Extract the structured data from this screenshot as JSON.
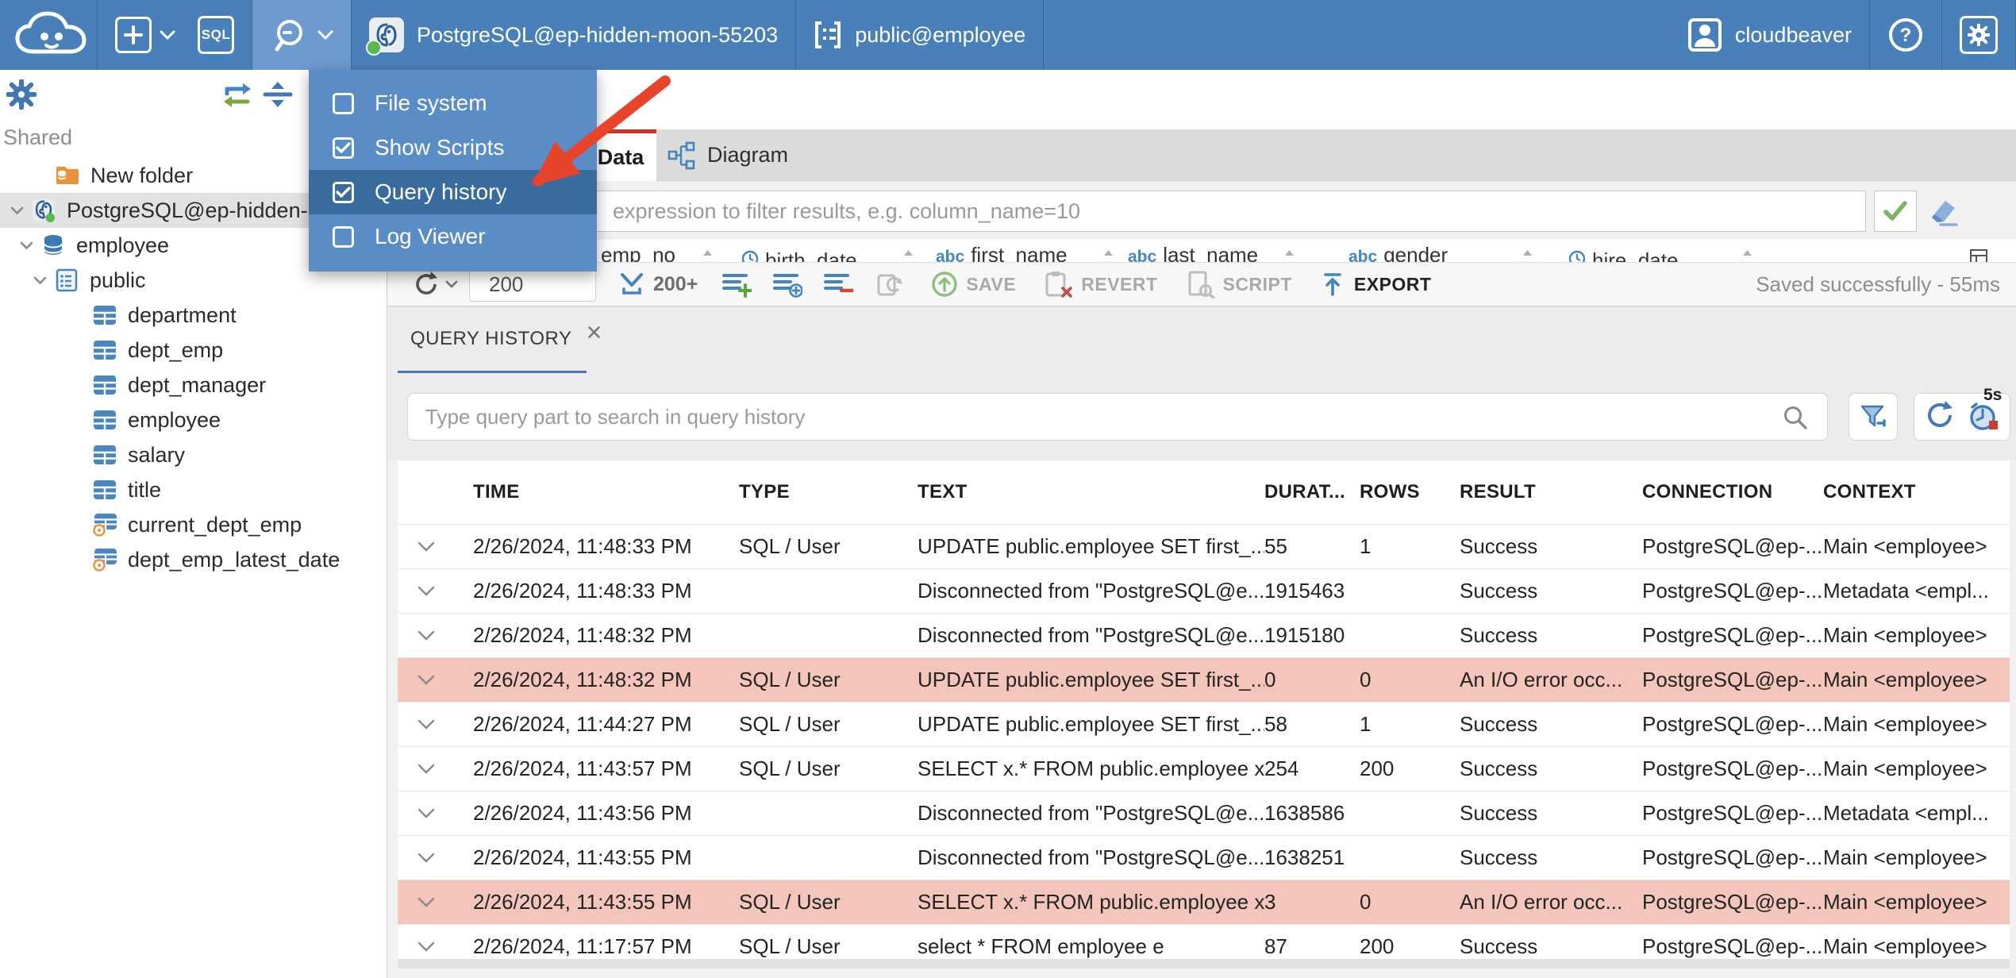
{
  "colors": {
    "topbar": "#4a80ba",
    "accent_red": "#d2302c",
    "error_row": "#f3c5bb",
    "tab_underline": "#4878ad",
    "icon_blue": "#4584c0"
  },
  "topbar": {
    "sql_label": "SQL",
    "connection_name": "PostgreSQL@ep-hidden-moon-55203",
    "schema_context": "public@employee",
    "username": "cloudbeaver"
  },
  "tools_menu": {
    "items": [
      {
        "label": "File system",
        "checked": false,
        "highlighted": false
      },
      {
        "label": "Show Scripts",
        "checked": true,
        "highlighted": false
      },
      {
        "label": "Query history",
        "checked": true,
        "highlighted": true
      },
      {
        "label": "Log Viewer",
        "checked": false,
        "highlighted": false
      }
    ]
  },
  "sidebar": {
    "section_label": "Shared",
    "items": [
      {
        "label": "New folder",
        "icon": "folder",
        "level": 0,
        "chevron": false,
        "selected": false
      },
      {
        "label": "PostgreSQL@ep-hidden-",
        "icon": "postgres",
        "level": 0,
        "chevron": true,
        "selected": true
      },
      {
        "label": "employee",
        "icon": "database",
        "level": 1,
        "chevron": true,
        "selected": false
      },
      {
        "label": "public",
        "icon": "schema",
        "level": 2,
        "chevron": true,
        "selected": false
      },
      {
        "label": "department",
        "icon": "table",
        "level": 3,
        "chevron": false,
        "selected": false
      },
      {
        "label": "dept_emp",
        "icon": "table",
        "level": 3,
        "chevron": false,
        "selected": false
      },
      {
        "label": "dept_manager",
        "icon": "table",
        "level": 3,
        "chevron": false,
        "selected": false
      },
      {
        "label": "employee",
        "icon": "table",
        "level": 3,
        "chevron": false,
        "selected": false
      },
      {
        "label": "salary",
        "icon": "table",
        "level": 3,
        "chevron": false,
        "selected": false
      },
      {
        "label": "title",
        "icon": "table",
        "level": 3,
        "chevron": false,
        "selected": false
      },
      {
        "label": "current_dept_emp",
        "icon": "view",
        "level": 3,
        "chevron": false,
        "selected": false
      },
      {
        "label": "dept_emp_latest_date",
        "icon": "view",
        "level": 3,
        "chevron": false,
        "selected": false
      }
    ]
  },
  "editor": {
    "tabs": {
      "data": "Data",
      "diagram": "Diagram"
    },
    "filter_placeholder": "expression to filter results, e.g. column_name=10",
    "grid_columns": [
      {
        "badge": "#",
        "label": ""
      },
      {
        "badge": "123",
        "label": "emp_no"
      },
      {
        "badge": "clock",
        "label": "birth_date"
      },
      {
        "badge": "abc",
        "label": "first_name"
      },
      {
        "badge": "abc",
        "label": "last_name"
      },
      {
        "badge": "abc",
        "label": "gender"
      },
      {
        "badge": "clock",
        "label": "hire_date"
      }
    ],
    "toolbar": {
      "row_limit": "200",
      "fetch_more": "200+",
      "save": "SAVE",
      "revert": "REVERT",
      "script": "SCRIPT",
      "export": "EXPORT",
      "status": "Saved successfully - 55ms"
    }
  },
  "query_history": {
    "tab_label": "QUERY HISTORY",
    "search_placeholder": "Type query part to search in query history",
    "auto_refresh_interval": "5s",
    "columns": [
      "TIME",
      "TYPE",
      "TEXT",
      "DURAT...",
      "ROWS",
      "RESULT",
      "CONNECTION",
      "CONTEXT"
    ],
    "rows": [
      {
        "time": "2/26/2024, 11:48:33 PM",
        "type": "SQL / User",
        "text": "UPDATE public.employee SET first_...",
        "duration": "55",
        "rows": "1",
        "result": "Success",
        "connection": "PostgreSQL@ep-...",
        "context": "Main <employee>",
        "error": false
      },
      {
        "time": "2/26/2024, 11:48:33 PM",
        "type": "",
        "text": "Disconnected from \"PostgreSQL@e...",
        "duration": "1915463",
        "rows": "",
        "result": "Success",
        "connection": "PostgreSQL@ep-...",
        "context": "Metadata <empl...",
        "error": false
      },
      {
        "time": "2/26/2024, 11:48:32 PM",
        "type": "",
        "text": "Disconnected from \"PostgreSQL@e...",
        "duration": "1915180",
        "rows": "",
        "result": "Success",
        "connection": "PostgreSQL@ep-...",
        "context": "Main <employee>",
        "error": false
      },
      {
        "time": "2/26/2024, 11:48:32 PM",
        "type": "SQL / User",
        "text": "UPDATE public.employee SET first_...",
        "duration": "0",
        "rows": "0",
        "result": "An I/O error occ...",
        "connection": "PostgreSQL@ep-...",
        "context": "Main <employee>",
        "error": true
      },
      {
        "time": "2/26/2024, 11:44:27 PM",
        "type": "SQL / User",
        "text": "UPDATE public.employee SET first_...",
        "duration": "58",
        "rows": "1",
        "result": "Success",
        "connection": "PostgreSQL@ep-...",
        "context": "Main <employee>",
        "error": false
      },
      {
        "time": "2/26/2024, 11:43:57 PM",
        "type": "SQL / User",
        "text": "SELECT x.* FROM public.employee x",
        "duration": "254",
        "rows": "200",
        "result": "Success",
        "connection": "PostgreSQL@ep-...",
        "context": "Main <employee>",
        "error": false
      },
      {
        "time": "2/26/2024, 11:43:56 PM",
        "type": "",
        "text": "Disconnected from \"PostgreSQL@e...",
        "duration": "1638586",
        "rows": "",
        "result": "Success",
        "connection": "PostgreSQL@ep-...",
        "context": "Metadata <empl...",
        "error": false
      },
      {
        "time": "2/26/2024, 11:43:55 PM",
        "type": "",
        "text": "Disconnected from \"PostgreSQL@e...",
        "duration": "1638251",
        "rows": "",
        "result": "Success",
        "connection": "PostgreSQL@ep-...",
        "context": "Main <employee>",
        "error": false
      },
      {
        "time": "2/26/2024, 11:43:55 PM",
        "type": "SQL / User",
        "text": "SELECT x.* FROM public.employee x",
        "duration": "3",
        "rows": "0",
        "result": "An I/O error occ...",
        "connection": "PostgreSQL@ep-...",
        "context": "Main <employee>",
        "error": true
      },
      {
        "time": "2/26/2024, 11:17:57 PM",
        "type": "SQL / User",
        "text": "select * FROM employee e",
        "duration": "87",
        "rows": "200",
        "result": "Success",
        "connection": "PostgreSQL@ep-...",
        "context": "Main <employee>",
        "error": false
      }
    ]
  }
}
